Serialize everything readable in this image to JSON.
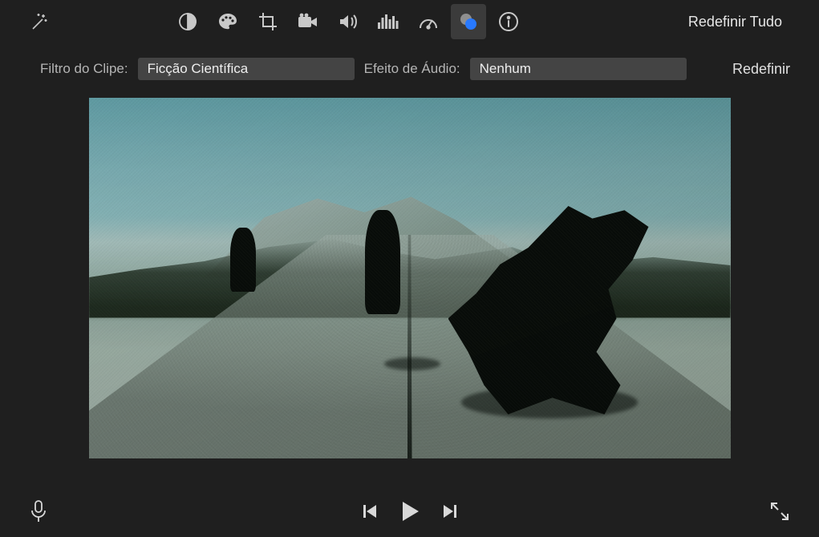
{
  "toolbar": {
    "reset_all": "Redefinir Tudo",
    "active_tool": "clip-filter",
    "icons": [
      "magic-wand",
      "color-balance",
      "palette",
      "crop",
      "camera",
      "volume",
      "equalizer",
      "speed",
      "clip-filter",
      "info"
    ]
  },
  "filter_row": {
    "clip_label": "Filtro do Clipe:",
    "clip_value": "Ficção Científica",
    "audio_label": "Efeito de Áudio:",
    "audio_value": "Nenhum",
    "reset": "Redefinir"
  },
  "transport": {
    "icons": [
      "microphone",
      "prev-frame",
      "play",
      "next-frame",
      "fullscreen"
    ]
  }
}
